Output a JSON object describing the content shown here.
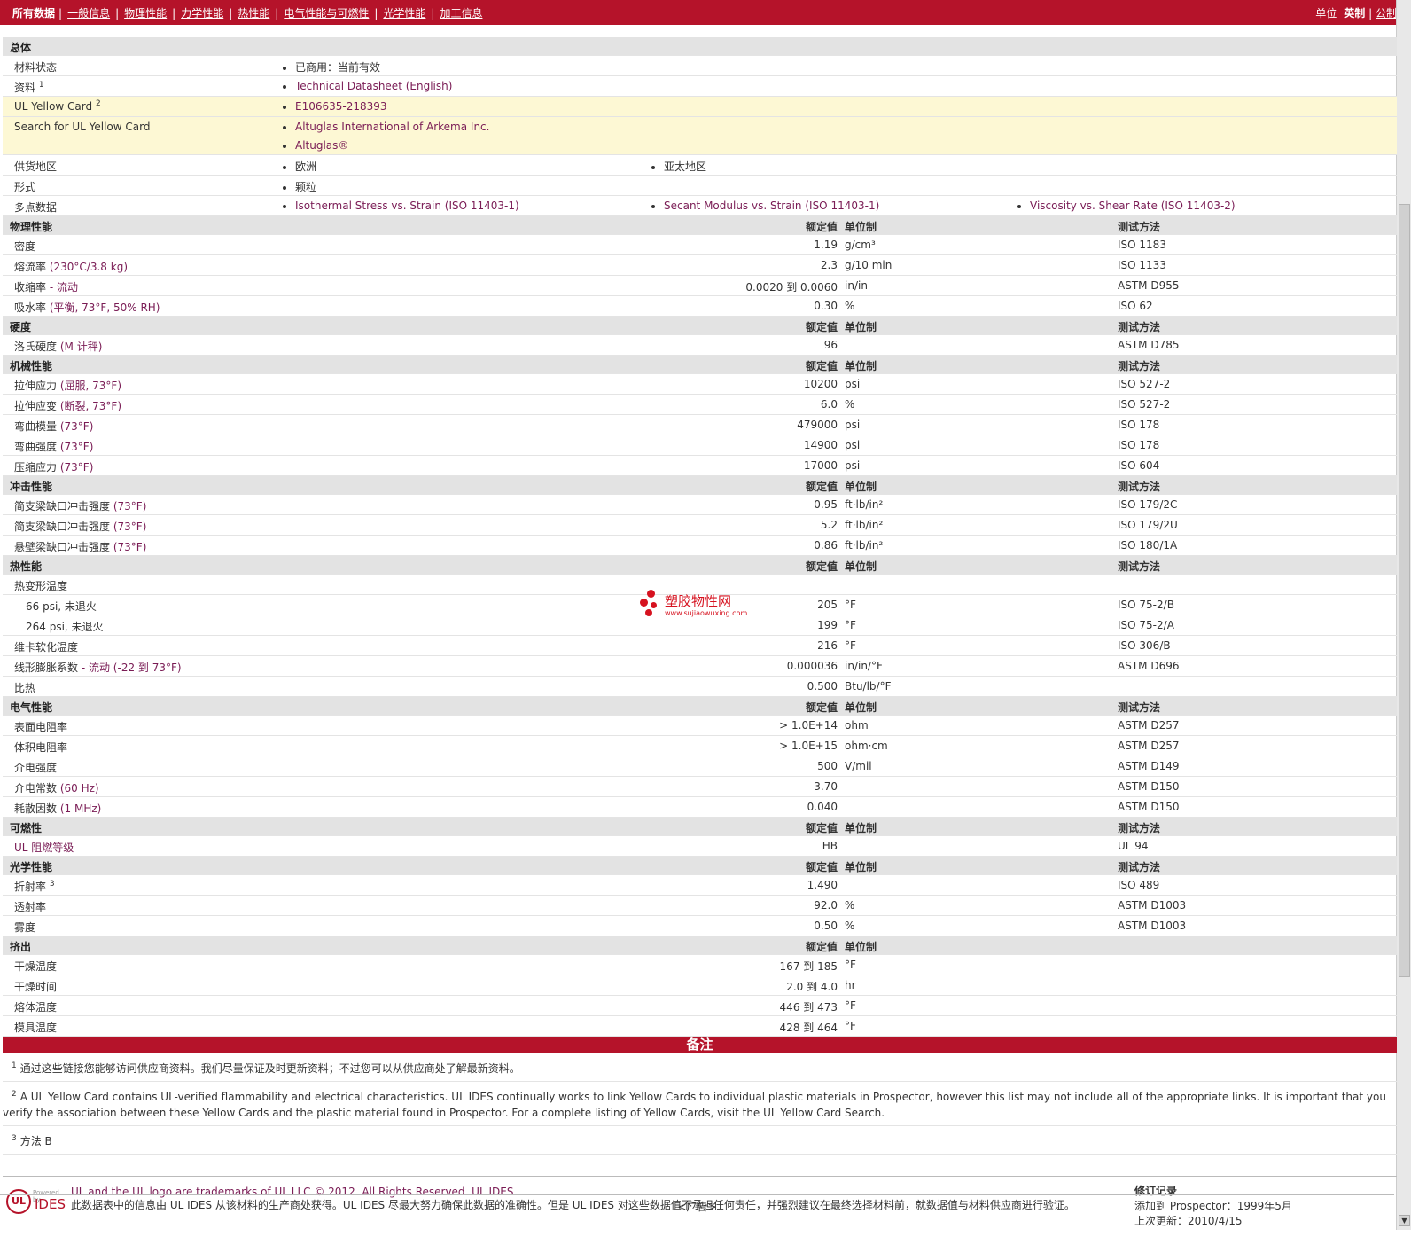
{
  "nav": {
    "current": "所有数据",
    "links": [
      "一般信息",
      "物理性能",
      "力学性能",
      "热性能",
      "电气性能与可燃性",
      "光学性能",
      "加工信息"
    ],
    "units_label": "单位",
    "units_current": "英制",
    "units_alt": "公制"
  },
  "general": {
    "title": "总体",
    "status_label": "材料状态",
    "status_value": "已商用：当前有效",
    "doc_label": "资料",
    "doc_sup": "1",
    "doc_link": "Technical Datasheet (English)",
    "ulcard_label": "UL Yellow Card",
    "ulcard_sup": "2",
    "ulcard_link": "E106635-218393",
    "search_label": "Search for UL Yellow Card",
    "search_links": [
      "Altuglas International of Arkema Inc.",
      "Altuglas®"
    ],
    "supply_label": "供货地区",
    "supply_values": [
      "欧洲",
      "亚太地区"
    ],
    "form_label": "形式",
    "form_value": "颗粒",
    "multipoint_label": "多点数据",
    "multipoint_values": [
      "Isothermal Stress vs. Strain (ISO 11403-1)",
      "Secant Modulus vs. Strain (ISO 11403-1)",
      "Viscosity vs. Shear Rate (ISO 11403-2)"
    ]
  },
  "headers": {
    "value": "额定值",
    "unit": "单位制",
    "method": "测试方法"
  },
  "sections": [
    {
      "title": "物理性能",
      "method_header": true,
      "rows": [
        {
          "label": "密度",
          "cond": "",
          "value": "1.19",
          "unit": "g/cm³",
          "method": "ISO 1183"
        },
        {
          "label": "熔流率",
          "cond": "(230°C/3.8 kg)",
          "value": "2.3",
          "unit": "g/10 min",
          "method": "ISO 1133"
        },
        {
          "label": "收缩率",
          "cond": "- 流动",
          "value": "0.0020 到 0.0060",
          "unit": "in/in",
          "method": "ASTM D955"
        },
        {
          "label": "吸水率",
          "cond": "(平衡, 73°F, 50% RH)",
          "value": "0.30",
          "unit": "%",
          "method": "ISO 62"
        }
      ]
    },
    {
      "title": "硬度",
      "method_header": true,
      "rows": [
        {
          "label": "洛氏硬度",
          "cond": "(M 计秤)",
          "value": "96",
          "unit": "",
          "method": "ASTM D785"
        }
      ]
    },
    {
      "title": "机械性能",
      "method_header": true,
      "rows": [
        {
          "label": "拉伸应力",
          "cond": "(屈服, 73°F)",
          "value": "10200",
          "unit": "psi",
          "method": "ISO 527-2"
        },
        {
          "label": "拉伸应变",
          "cond": "(断裂, 73°F)",
          "value": "6.0",
          "unit": "%",
          "method": "ISO 527-2"
        },
        {
          "label": "弯曲模量",
          "cond": "(73°F)",
          "value": "479000",
          "unit": "psi",
          "method": "ISO 178"
        },
        {
          "label": "弯曲强度",
          "cond": "(73°F)",
          "value": "14900",
          "unit": "psi",
          "method": "ISO 178"
        },
        {
          "label": "压缩应力",
          "cond": "(73°F)",
          "value": "17000",
          "unit": "psi",
          "method": "ISO 604"
        }
      ]
    },
    {
      "title": "冲击性能",
      "method_header": true,
      "rows": [
        {
          "label": "简支梁缺口冲击强度",
          "cond": "(73°F)",
          "value": "0.95",
          "unit": "ft·lb/in²",
          "method": "ISO 179/2C"
        },
        {
          "label": "简支梁缺口冲击强度",
          "cond": "(73°F)",
          "value": "5.2",
          "unit": "ft·lb/in²",
          "method": "ISO 179/2U"
        },
        {
          "label": "悬壁梁缺口冲击强度",
          "cond": "(73°F)",
          "value": "0.86",
          "unit": "ft·lb/in²",
          "method": "ISO 180/1A"
        }
      ]
    },
    {
      "title": "热性能",
      "method_header": true,
      "rows": [
        {
          "label": "热变形温度",
          "cond": "",
          "value": "",
          "unit": "",
          "method": ""
        },
        {
          "label": "66 psi, 未退火",
          "cond": "",
          "value": "205",
          "unit": "°F",
          "method": "ISO 75-2/B",
          "sub": true
        },
        {
          "label": "264 psi, 未退火",
          "cond": "",
          "value": "199",
          "unit": "°F",
          "method": "ISO 75-2/A",
          "sub": true
        },
        {
          "label": "维卡软化温度",
          "cond": "",
          "value": "216",
          "unit": "°F",
          "method": "ISO 306/B"
        },
        {
          "label": "线形膨胀系数",
          "cond": "- 流动 (-22 到 73°F)",
          "value": "0.000036",
          "unit": "in/in/°F",
          "method": "ASTM D696"
        },
        {
          "label": "比热",
          "cond": "",
          "value": "0.500",
          "unit": "Btu/lb/°F",
          "method": ""
        }
      ]
    },
    {
      "title": "电气性能",
      "method_header": true,
      "rows": [
        {
          "label": "表面电阻率",
          "cond": "",
          "value": "> 1.0E+14",
          "unit": "ohm",
          "method": "ASTM D257"
        },
        {
          "label": "体积电阻率",
          "cond": "",
          "value": "> 1.0E+15",
          "unit": "ohm·cm",
          "method": "ASTM D257"
        },
        {
          "label": "介电强度",
          "cond": "",
          "value": "500",
          "unit": "V/mil",
          "method": "ASTM D149"
        },
        {
          "label": "介电常数",
          "cond": "(60 Hz)",
          "value": "3.70",
          "unit": "",
          "method": "ASTM D150"
        },
        {
          "label": "耗散因数",
          "cond": "(1 MHz)",
          "value": "0.040",
          "unit": "",
          "method": "ASTM D150"
        }
      ]
    },
    {
      "title": "可燃性",
      "method_header": true,
      "rows": [
        {
          "label": "UL 阻燃等级",
          "cond": "",
          "value": "HB",
          "unit": "",
          "method": "UL 94",
          "linkish": true
        }
      ]
    },
    {
      "title": "光学性能",
      "method_header": true,
      "rows": [
        {
          "label": "折射率",
          "sup": "3",
          "cond": "",
          "value": "1.490",
          "unit": "",
          "method": "ISO 489"
        },
        {
          "label": "透射率",
          "cond": "",
          "value": "92.0",
          "unit": "%",
          "method": "ASTM D1003"
        },
        {
          "label": "雾度",
          "cond": "",
          "value": "0.50",
          "unit": "%",
          "method": "ASTM D1003"
        }
      ]
    },
    {
      "title": "挤出",
      "method_header": false,
      "rows": [
        {
          "label": "干燥温度",
          "cond": "",
          "value": "167 到 185",
          "unit": "°F",
          "method": ""
        },
        {
          "label": "干燥时间",
          "cond": "",
          "value": "2.0 到 4.0",
          "unit": "hr",
          "method": ""
        },
        {
          "label": "熔体温度",
          "cond": "",
          "value": "446 到 473",
          "unit": "°F",
          "method": ""
        },
        {
          "label": "模具温度",
          "cond": "",
          "value": "428 到 464",
          "unit": "°F",
          "method": ""
        }
      ]
    }
  ],
  "notes": {
    "title": "备注",
    "items": [
      {
        "num": "1",
        "text": "通过这些链接您能够访问供应商资料。我们尽量保证及时更新资料；不过您可以从供应商处了解最新资料。"
      },
      {
        "num": "2",
        "text": "A UL Yellow Card contains UL-verified flammability and electrical characteristics. UL IDES continually works to link Yellow Cards to individual plastic materials in Prospector, however this list may not include all of the appropriate links. It is important that you verify the association between these Yellow Cards and the plastic material found in Prospector. For a complete listing of Yellow Cards, visit the UL Yellow Card Search."
      },
      {
        "num": "3",
        "text": "方法 B"
      }
    ]
  },
  "footer": {
    "logo_powered": "Powered by",
    "logo_ul": "UL",
    "logo_ides": "IDES",
    "line1": "UL and the UL logo are trademarks of UL LLC © 2012. All Rights Reserved. UL IDES",
    "line2": "此数据表中的信息由 UL IDES 从该材料的生产商处获得。UL IDES 尽最大努力确保此数据的准确性。但是 UL IDES 对这些数据值不承担任何责任，并强烈建议在最终选择材料前，就数据值与材料供应商进行验证。",
    "rev_title": "修订记录",
    "rev_added_label": "添加到 Prospector：",
    "rev_added_value": "1999年5月",
    "rev_updated_label": "上次更新：",
    "rev_updated_value": "2010/4/15",
    "ad": "<广告>"
  },
  "watermark": {
    "text": "塑胶物性网",
    "url": "www.sujiaowuxing.com"
  },
  "colors": {
    "brand_red": "#b5132a",
    "link": "#7a1c55",
    "section_bg": "#e3e3e3",
    "highlight": "#fdf8d4"
  }
}
